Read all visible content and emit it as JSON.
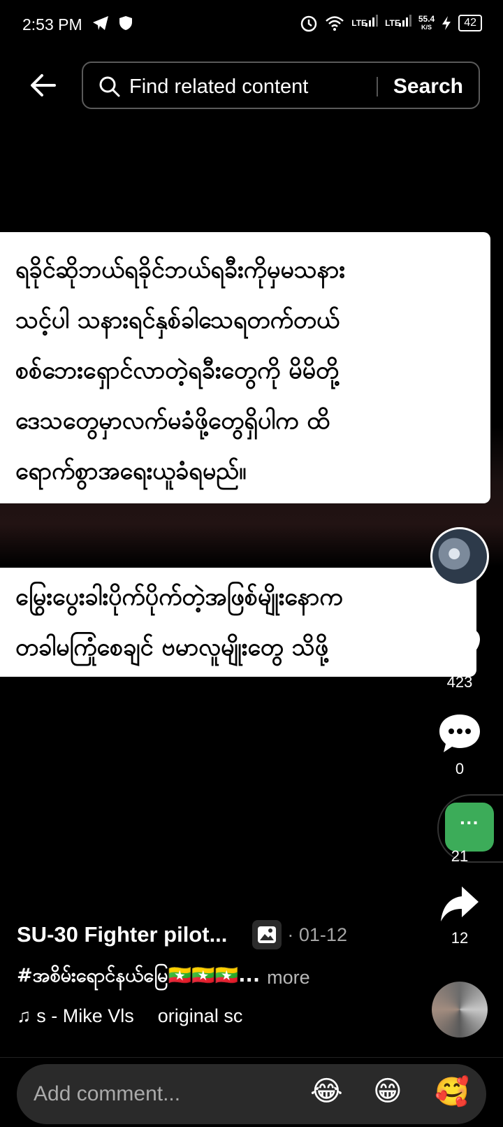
{
  "status_bar": {
    "time": "2:53 PM",
    "net1": "LTE",
    "net2": "LTE",
    "speed_value": "55.4",
    "speed_unit": "K/S",
    "battery": "42"
  },
  "search": {
    "placeholder": "Find related content",
    "button_label": "Search"
  },
  "captions": {
    "block1": "ရခိုင်ဆိုဘယ်ရခိုင်ဘယ်ရခီးကိုမှမသနား\nသင့်ပါ သနားရင်နှစ်ခါသေရတက်တယ်\nစစ်ဘေးရှောင်လာတဲ့ရခီးတွေကို မိမိတို့\nဒေသတွေမှာလက်မခံဖို့တွေရှိပါက ထိ\nရောက်စွာအရေးယူခံရမည်။",
    "block2": "မြွေးပွေးခါးပိုက်ပိုက်တဲ့အဖြစ်မျိုးနောက\nတခါမကြုံစေချင် ဗမာလူမျိုးတွေ သိဖို့"
  },
  "rail": {
    "likes": "423",
    "comments": "0",
    "shares_hidden": "21",
    "forwards": "12"
  },
  "post": {
    "title": "SU-30 Fighter pilot...",
    "date": "· 01-12",
    "tags": "#အစိမ်းရောင်နယ်မြေ🇲🇲🇲🇲🇲🇲...",
    "more_label": "more",
    "music_note": "♫",
    "music_artist": "s - Mike Vls",
    "music_track": "original sc"
  },
  "comment_bar": {
    "placeholder": "Add comment...",
    "emoji_1": "😂",
    "emoji_2": "😁",
    "emoji_3": "🥰"
  },
  "floating_button": {
    "label": "···"
  },
  "icons": [
    "telegram-icon",
    "shield-icon",
    "alarm-icon",
    "wifi-icon",
    "charging-icon",
    "back-arrow-icon",
    "search-icon",
    "heart-icon",
    "comment-icon",
    "share-icon",
    "image-icon"
  ],
  "colors": {
    "accent_green": "#3cac59",
    "background": "#000000"
  }
}
